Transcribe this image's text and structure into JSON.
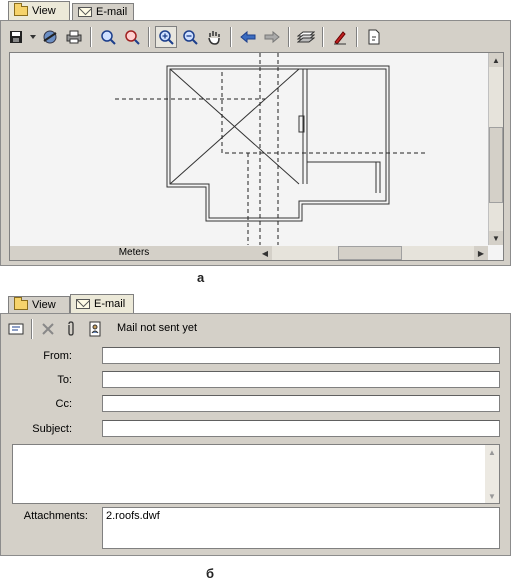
{
  "top": {
    "tabs": [
      {
        "label": "View",
        "icon": "folder-icon",
        "active": true
      },
      {
        "label": "E-mail",
        "icon": "envelope-icon",
        "active": false
      }
    ],
    "toolbar_icons": [
      "save-icon",
      "dropdown-arrow-icon",
      "publish-icon",
      "print-icon",
      "zoom-fit-icon",
      "zoom-window-icon",
      "zoom-in-icon",
      "zoom-out-icon",
      "pan-hand-icon",
      "previous-view-icon",
      "next-view-icon",
      "layers-icon",
      "markup-pen-icon",
      "properties-icon"
    ],
    "units_label": "Meters",
    "caption": "a"
  },
  "bottom": {
    "tabs": [
      {
        "label": "View",
        "icon": "folder-icon",
        "active": false
      },
      {
        "label": "E-mail",
        "icon": "envelope-icon",
        "active": true
      }
    ],
    "status": "Mail not sent yet",
    "fields": {
      "from_label": "From:",
      "to_label": "To:",
      "cc_label": "Cc:",
      "subject_label": "Subject:",
      "attachments_label": "Attachments:",
      "attachment_value": "2.roofs.dwf"
    },
    "caption": "б"
  }
}
